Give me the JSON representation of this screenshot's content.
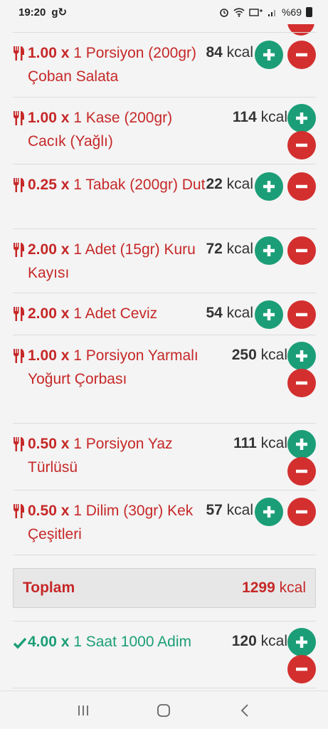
{
  "status_bar": {
    "time": "19:20",
    "app_icons": "g↻",
    "battery": "%69"
  },
  "entries": [
    {
      "qty": "1.00 x",
      "desc": "1 Porsiyon (200gr) Çoban Salata",
      "kcal_num": "84",
      "kcal_unit": "kcal"
    },
    {
      "qty": "1.00 x",
      "desc": "1 Kase (200gr) Cacık (Yağlı)",
      "kcal_num": "114",
      "kcal_unit": "kcal"
    },
    {
      "qty": "0.25 x",
      "desc": "1 Tabak (200gr) Dut",
      "kcal_num": "22",
      "kcal_unit": "kcal"
    },
    {
      "qty": "2.00 x",
      "desc": "1 Adet (15gr) Kuru Kayısı",
      "kcal_num": "72",
      "kcal_unit": "kcal"
    },
    {
      "qty": "2.00 x",
      "desc": "1 Adet Ceviz",
      "kcal_num": "54",
      "kcal_unit": "kcal"
    },
    {
      "qty": "1.00 x",
      "desc": "1 Porsiyon Yarmalı Yoğurt Çorbası",
      "kcal_num": "250",
      "kcal_unit": "kcal"
    },
    {
      "qty": "0.50 x",
      "desc": "1 Porsiyon Yaz Türlüsü",
      "kcal_num": "111",
      "kcal_unit": "kcal"
    },
    {
      "qty": "0.50 x",
      "desc": "1 Dilim (30gr) Kek Çeşitleri",
      "kcal_num": "57",
      "kcal_unit": "kcal"
    }
  ],
  "total": {
    "label": "Toplam",
    "kcal_num": "1299",
    "kcal_unit": "kcal"
  },
  "activities": [
    {
      "qty": "4.00 x",
      "desc": "1 Saat 1000 Adim",
      "kcal_num": "120",
      "kcal_unit": "kcal"
    }
  ],
  "colors": {
    "food": "#c62828",
    "activity": "#1b9e77",
    "add": "#1b9e77",
    "remove": "#d32f2f"
  }
}
